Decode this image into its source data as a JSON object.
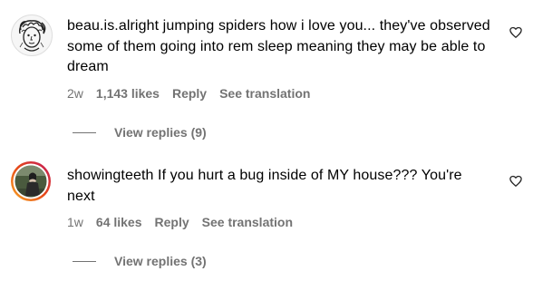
{
  "comments": [
    {
      "username": "beau.is.alright",
      "text": "jumping spiders how i love you... they've observed some of them going into rem sleep meaning they may be able to dream",
      "time": "2w",
      "likes": "1,143 likes",
      "reply_label": "Reply",
      "translate_label": "See translation",
      "view_replies": "View replies (9)",
      "avatar_icon": "sketch-portrait-avatar",
      "like_icon": "heart-outline-icon"
    },
    {
      "username": "showingteeth",
      "text": "If you hurt a bug inside of MY house??? You're next",
      "time": "1w",
      "likes": "64 likes",
      "reply_label": "Reply",
      "translate_label": "See translation",
      "view_replies": "View replies (3)",
      "avatar_icon": "story-ring-photo-avatar",
      "like_icon": "heart-outline-icon"
    }
  ],
  "colors": {
    "text": "#000000",
    "secondary": "#737373",
    "story_ring_start": "#f9a825",
    "story_ring_end": "#c2185b"
  }
}
